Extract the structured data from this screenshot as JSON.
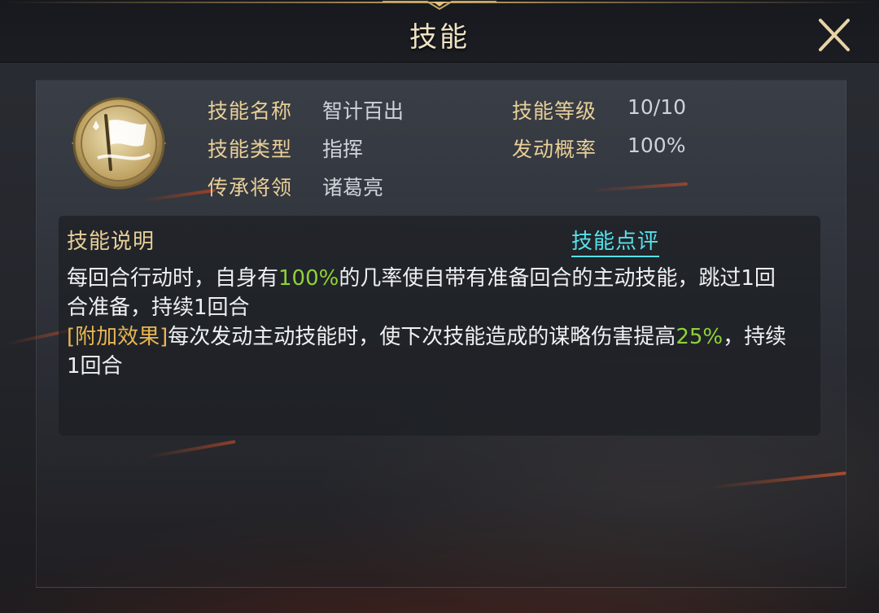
{
  "header": {
    "title": "技能",
    "close_icon": "close-icon"
  },
  "skill": {
    "icon": "flag-emblem-icon",
    "fields": {
      "name_label": "技能名称",
      "name_value": "智计百出",
      "type_label": "技能类型",
      "type_value": "指挥",
      "inherit_label": "传承将领",
      "inherit_value": "诸葛亮",
      "level_label": "技能等级",
      "level_value": "10/10",
      "rate_label": "发动概率",
      "rate_value": "100%"
    }
  },
  "description": {
    "title": "技能说明",
    "review_link": "技能点评",
    "line1_pre": "每回合行动时，自身有",
    "line1_value": "100%",
    "line1_post": "的几率使自带有准备回合的主动技能，跳过1回合准备，持续1回合",
    "extra_tag": "[附加效果]",
    "line2_pre": "每次发动主动技能时，使下次技能造成的谋略伤害提高",
    "line2_value": "25%",
    "line2_post": "，持续1回合"
  },
  "colors": {
    "label_gold": "#e8cf98",
    "value_gray": "#cfd3d8",
    "highlight_green": "#8ed238",
    "tag_orange": "#e8b552",
    "link_cyan": "#56e2ea"
  }
}
